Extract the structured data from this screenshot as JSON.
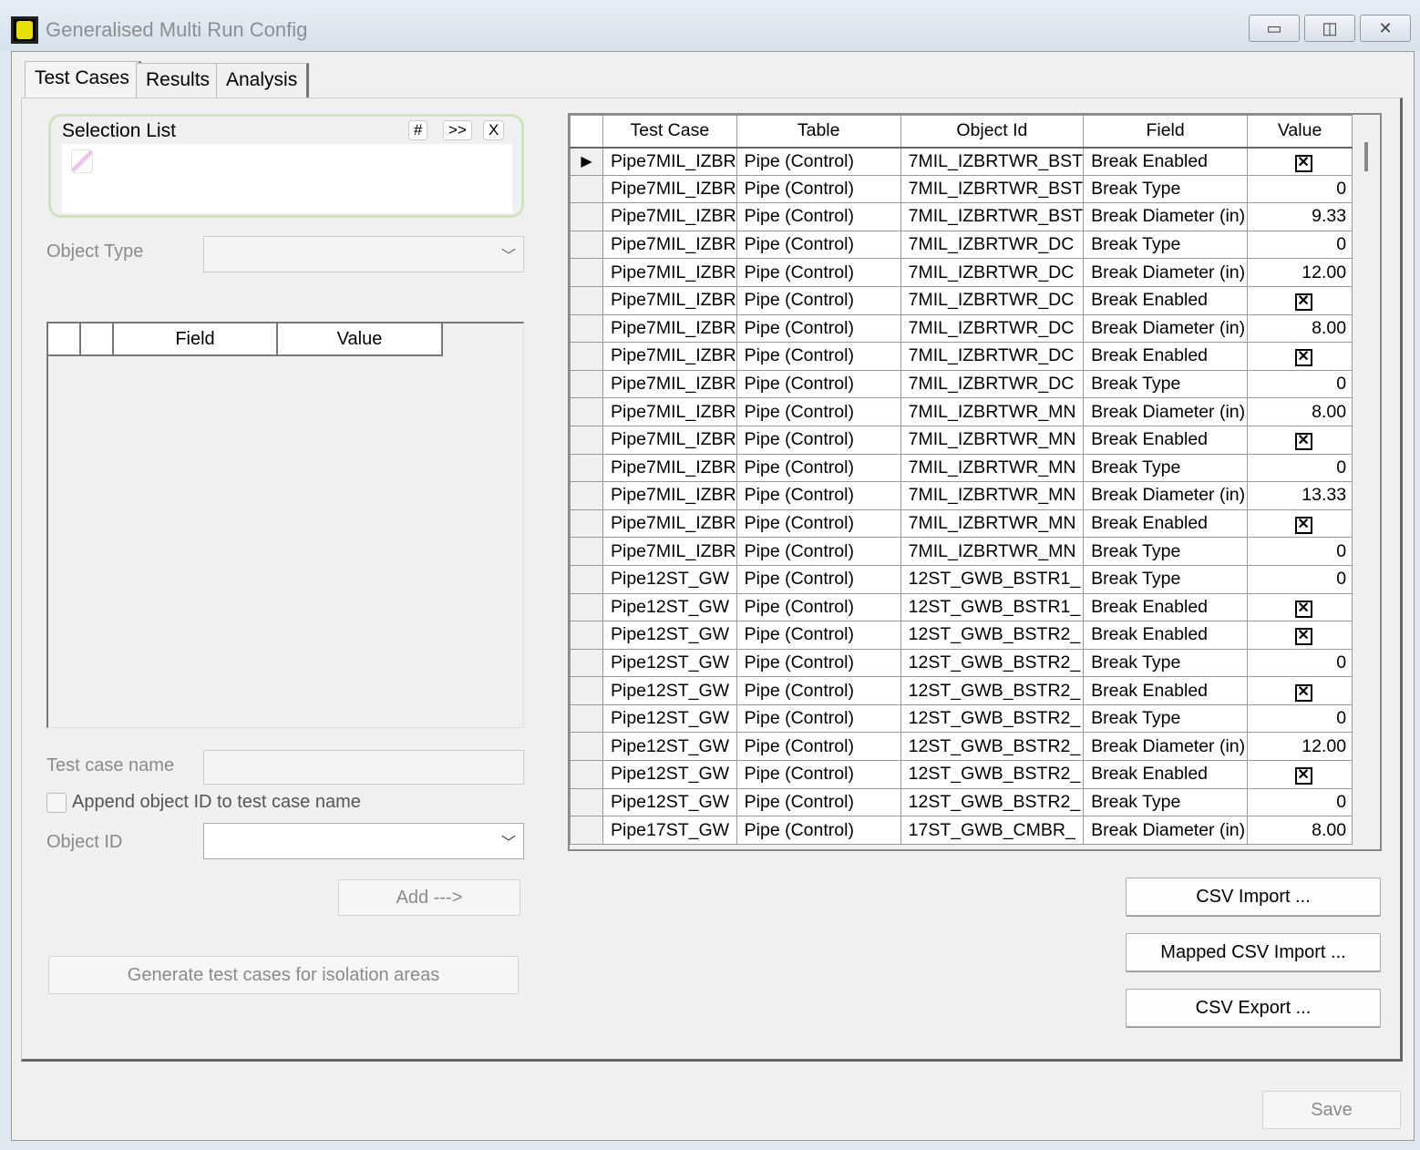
{
  "window": {
    "title": "Generalised Multi Run Config",
    "minimize": "▭",
    "restore": "◫",
    "close": "✕"
  },
  "tabs": [
    "Test Cases",
    "Results",
    "Analysis"
  ],
  "selection_list": {
    "label": "Selection List",
    "btn_hash": "#",
    "btn_next": ">>",
    "btn_clear": "X"
  },
  "object_type": {
    "label": "Object Type",
    "value": ""
  },
  "field_table": {
    "headers": [
      "Field",
      "Value"
    ]
  },
  "test_case_name": {
    "label": "Test case name",
    "value": ""
  },
  "append_checkbox": {
    "label": "Append object ID to test case name",
    "checked": false
  },
  "object_id": {
    "label": "Object ID",
    "value": ""
  },
  "add_button": "Add --->",
  "generate_button": "Generate test cases for isolation areas",
  "grid": {
    "headers": [
      "Test Case",
      "Table",
      "Object Id",
      "Field",
      "Value"
    ],
    "rows": [
      [
        "Pipe7MIL_IZBR",
        "Pipe (Control)",
        "7MIL_IZBRTWR_BST",
        "Break Enabled",
        true
      ],
      [
        "Pipe7MIL_IZBR",
        "Pipe (Control)",
        "7MIL_IZBRTWR_BST",
        "Break Type",
        "0"
      ],
      [
        "Pipe7MIL_IZBR",
        "Pipe (Control)",
        "7MIL_IZBRTWR_BST",
        "Break Diameter (in)",
        "9.33"
      ],
      [
        "Pipe7MIL_IZBR",
        "Pipe (Control)",
        "7MIL_IZBRTWR_DC",
        "Break Type",
        "0"
      ],
      [
        "Pipe7MIL_IZBR",
        "Pipe (Control)",
        "7MIL_IZBRTWR_DC",
        "Break Diameter (in)",
        "12.00"
      ],
      [
        "Pipe7MIL_IZBR",
        "Pipe (Control)",
        "7MIL_IZBRTWR_DC",
        "Break Enabled",
        true
      ],
      [
        "Pipe7MIL_IZBR",
        "Pipe (Control)",
        "7MIL_IZBRTWR_DC",
        "Break Diameter (in)",
        "8.00"
      ],
      [
        "Pipe7MIL_IZBR",
        "Pipe (Control)",
        "7MIL_IZBRTWR_DC",
        "Break Enabled",
        true
      ],
      [
        "Pipe7MIL_IZBR",
        "Pipe (Control)",
        "7MIL_IZBRTWR_DC",
        "Break Type",
        "0"
      ],
      [
        "Pipe7MIL_IZBR",
        "Pipe (Control)",
        "7MIL_IZBRTWR_MN",
        "Break Diameter (in)",
        "8.00"
      ],
      [
        "Pipe7MIL_IZBR",
        "Pipe (Control)",
        "7MIL_IZBRTWR_MN",
        "Break Enabled",
        true
      ],
      [
        "Pipe7MIL_IZBR",
        "Pipe (Control)",
        "7MIL_IZBRTWR_MN",
        "Break Type",
        "0"
      ],
      [
        "Pipe7MIL_IZBR",
        "Pipe (Control)",
        "7MIL_IZBRTWR_MN",
        "Break Diameter (in)",
        "13.33"
      ],
      [
        "Pipe7MIL_IZBR",
        "Pipe (Control)",
        "7MIL_IZBRTWR_MN",
        "Break Enabled",
        true
      ],
      [
        "Pipe7MIL_IZBR",
        "Pipe (Control)",
        "7MIL_IZBRTWR_MN",
        "Break Type",
        "0"
      ],
      [
        "Pipe12ST_GW",
        "Pipe (Control)",
        "12ST_GWB_BSTR1_",
        "Break Type",
        "0"
      ],
      [
        "Pipe12ST_GW",
        "Pipe (Control)",
        "12ST_GWB_BSTR1_",
        "Break Enabled",
        true
      ],
      [
        "Pipe12ST_GW",
        "Pipe (Control)",
        "12ST_GWB_BSTR2_",
        "Break Enabled",
        true
      ],
      [
        "Pipe12ST_GW",
        "Pipe (Control)",
        "12ST_GWB_BSTR2_",
        "Break Type",
        "0"
      ],
      [
        "Pipe12ST_GW",
        "Pipe (Control)",
        "12ST_GWB_BSTR2_",
        "Break Enabled",
        true
      ],
      [
        "Pipe12ST_GW",
        "Pipe (Control)",
        "12ST_GWB_BSTR2_",
        "Break Type",
        "0"
      ],
      [
        "Pipe12ST_GW",
        "Pipe (Control)",
        "12ST_GWB_BSTR2_",
        "Break Diameter (in)",
        "12.00"
      ],
      [
        "Pipe12ST_GW",
        "Pipe (Control)",
        "12ST_GWB_BSTR2_",
        "Break Enabled",
        true
      ],
      [
        "Pipe12ST_GW",
        "Pipe (Control)",
        "12ST_GWB_BSTR2_",
        "Break Type",
        "0"
      ],
      [
        "Pipe17ST_GW",
        "Pipe (Control)",
        "17ST_GWB_CMBR_",
        "Break Diameter (in)",
        "8.00"
      ]
    ]
  },
  "csv_import": "CSV Import ...",
  "mapped_csv_import": "Mapped CSV Import ...",
  "csv_export": "CSV Export ...",
  "save": "Save"
}
